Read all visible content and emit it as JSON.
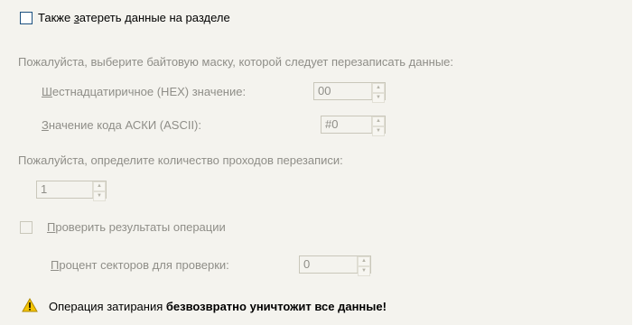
{
  "wipe_partition": {
    "label_accel": "Т",
    "label_pre": "акже ",
    "label_ul": "з",
    "label_post": "атереть данные на разделе",
    "checked": false
  },
  "byte_mask": {
    "prompt": "Пожалуйста, выберите байтовую маску, которой следует перезаписать данные:",
    "hex_label_ul": "Ш",
    "hex_label_rest": "естнадцатиричное (HEX) значение:",
    "hex_value": "00",
    "ascii_label_ul": "З",
    "ascii_label_rest": "начение кода АСКИ (ASCII):",
    "ascii_value": "#0"
  },
  "passes": {
    "prompt": "Пожалуйста, определите количество проходов перезаписи:",
    "value": "1"
  },
  "verify": {
    "label_ul": "П",
    "label_rest": "роверить результаты операции",
    "checked": false,
    "percent_label_ul": "П",
    "percent_label_rest": "роцент секторов для проверки:",
    "percent_value": "0"
  },
  "warning": {
    "icon": "warning-icon",
    "text_normal": "Операция затирания ",
    "text_bold": "безвозвратно уничтожит все данные!"
  },
  "colors": {
    "panel_bg": "#f4f3ee",
    "disabled_text": "#8f8e88",
    "checkbox_border": "#1c5180"
  }
}
